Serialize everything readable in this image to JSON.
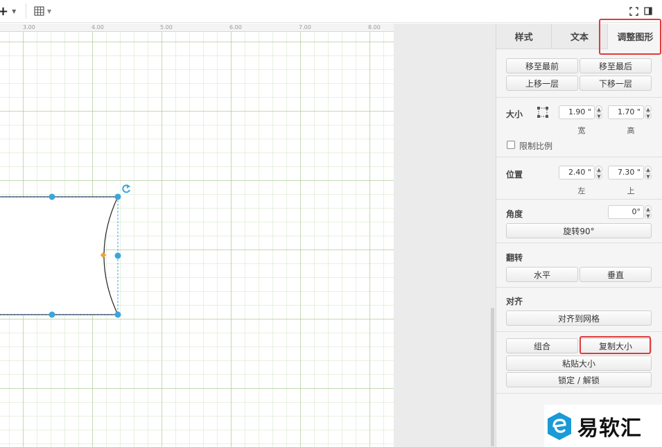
{
  "ruler": {
    "labels": [
      "3.00",
      "4.00",
      "5.00",
      "6.00",
      "7.00",
      "8.00"
    ]
  },
  "panel": {
    "tabs": [
      {
        "label": "样式"
      },
      {
        "label": "文本"
      },
      {
        "label": "调整图形"
      }
    ],
    "arrange": {
      "to_front": "移至最前",
      "to_back": "移至最后",
      "up_one": "上移一层",
      "down_one": "下移一层"
    },
    "size": {
      "label": "大小",
      "width_value": "1.90 \"",
      "height_value": "1.70 \"",
      "width_label": "宽",
      "height_label": "高",
      "lock_ratio_label": "限制比例",
      "lock_ratio_checked": false
    },
    "position": {
      "label": "位置",
      "left_value": "2.40 \"",
      "top_value": "7.30 \"",
      "left_label": "左",
      "top_label": "上"
    },
    "angle": {
      "label": "角度",
      "value": "0°",
      "rotate_label": "旋转90°"
    },
    "flip": {
      "label": "翻转",
      "horizontal": "水平",
      "vertical": "垂直"
    },
    "align": {
      "label": "对齐",
      "to_grid": "对齐到网格"
    },
    "misc": {
      "group": "组合",
      "copy_size": "复制大小",
      "paste_size": "粘贴大小",
      "lock_unlock": "锁定 / 解锁"
    }
  },
  "watermark": {
    "text": "易软汇"
  },
  "colors": {
    "accent_highlight": "#e03a3a",
    "handle": "#3ba6dc",
    "control_point": "#f0a030"
  },
  "icons": [
    "plus-icon",
    "caret-down-icon",
    "table-icon",
    "fullscreen-icon",
    "panel-toggle-icon",
    "resize-icon",
    "rotate-icon"
  ]
}
